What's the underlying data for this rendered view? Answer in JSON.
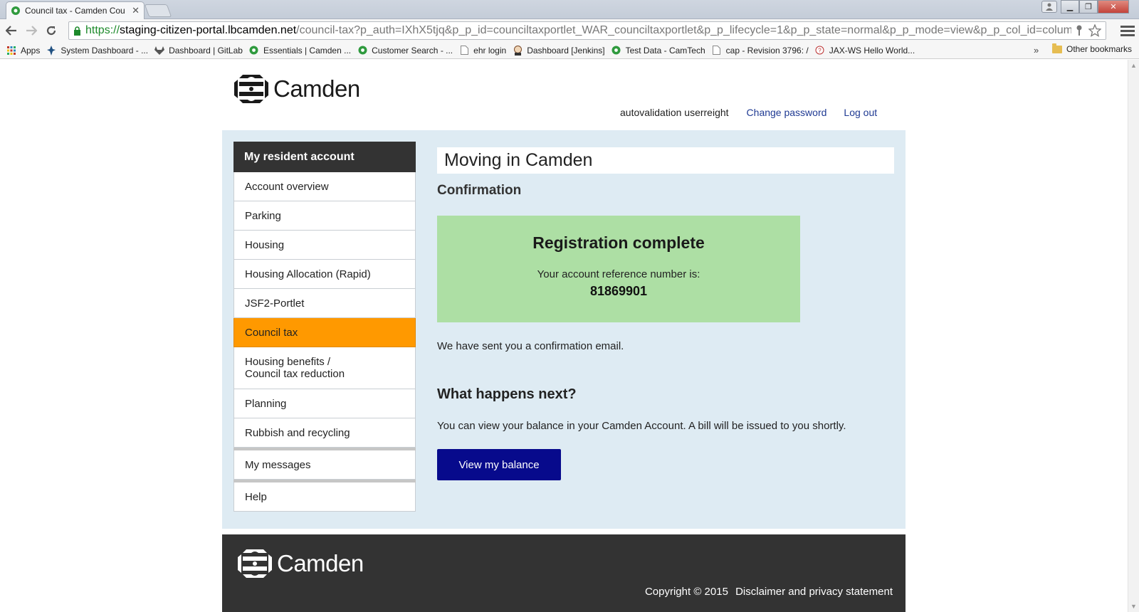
{
  "browser": {
    "tab_title": "Council tax - Camden Cou",
    "url_scheme": "https://",
    "url_host": "staging-citizen-portal.lbcamden.net",
    "url_path": "/council-tax?p_auth=IXhX5tjq&p_p_id=counciltaxportlet_WAR_counciltaxportlet&p_p_lifecycle=1&p_p_state=normal&p_p_mode=view&p_p_col_id=columr",
    "bookmarks": [
      {
        "label": "Apps",
        "icon": "apps-grid-icon"
      },
      {
        "label": "System Dashboard - ...",
        "icon": "jira-icon"
      },
      {
        "label": "Dashboard | GitLab",
        "icon": "gitlab-icon"
      },
      {
        "label": "Essentials | Camden ...",
        "icon": "camden-icon"
      },
      {
        "label": "Customer Search - ...",
        "icon": "camden-icon"
      },
      {
        "label": "ehr login",
        "icon": "page-icon"
      },
      {
        "label": "Dashboard [Jenkins]",
        "icon": "jenkins-icon"
      },
      {
        "label": "Test Data - CamTech",
        "icon": "camden-icon"
      },
      {
        "label": "cap - Revision 3796: /",
        "icon": "page-icon"
      },
      {
        "label": "JAX-WS Hello World...",
        "icon": "site-icon"
      }
    ],
    "more_label": "»",
    "other_bookmarks": "Other bookmarks"
  },
  "header": {
    "logo_text": "Camden",
    "username": "autovalidation userreight",
    "change_password": "Change password",
    "log_out": "Log out"
  },
  "sidebar": {
    "heading": "My resident account",
    "items": [
      {
        "label": "Account overview"
      },
      {
        "label": "Parking"
      },
      {
        "label": "Housing"
      },
      {
        "label": "Housing Allocation (Rapid)"
      },
      {
        "label": "JSF2-Portlet"
      },
      {
        "label": "Council tax",
        "active": true
      },
      {
        "label": "Housing benefits /",
        "label2": "Council tax reduction"
      },
      {
        "label": "Planning"
      },
      {
        "label": "Rubbish and recycling"
      }
    ],
    "extra_items": [
      {
        "label": "My messages"
      },
      {
        "label": "Help"
      }
    ]
  },
  "main": {
    "title": "Moving in Camden",
    "subtitle": "Confirmation",
    "success_heading": "Registration complete",
    "reference_label": "Your account reference number is:",
    "reference_number": "81869901",
    "sent_text": "We have sent you a confirmation email.",
    "next_heading": "What happens next?",
    "next_text": "You can view your balance in your Camden Account. A bill will be issued to you shortly.",
    "balance_button": "View my balance"
  },
  "footer": {
    "logo_text": "Camden",
    "copyright": "Copyright © 2015",
    "disclaimer": "Disclaimer and privacy statement"
  },
  "colors": {
    "active_nav": "#ff9900",
    "success_bg": "#addfa4",
    "primary_button": "#070a8c",
    "content_bg": "#deebf3",
    "dark": "#333333"
  }
}
